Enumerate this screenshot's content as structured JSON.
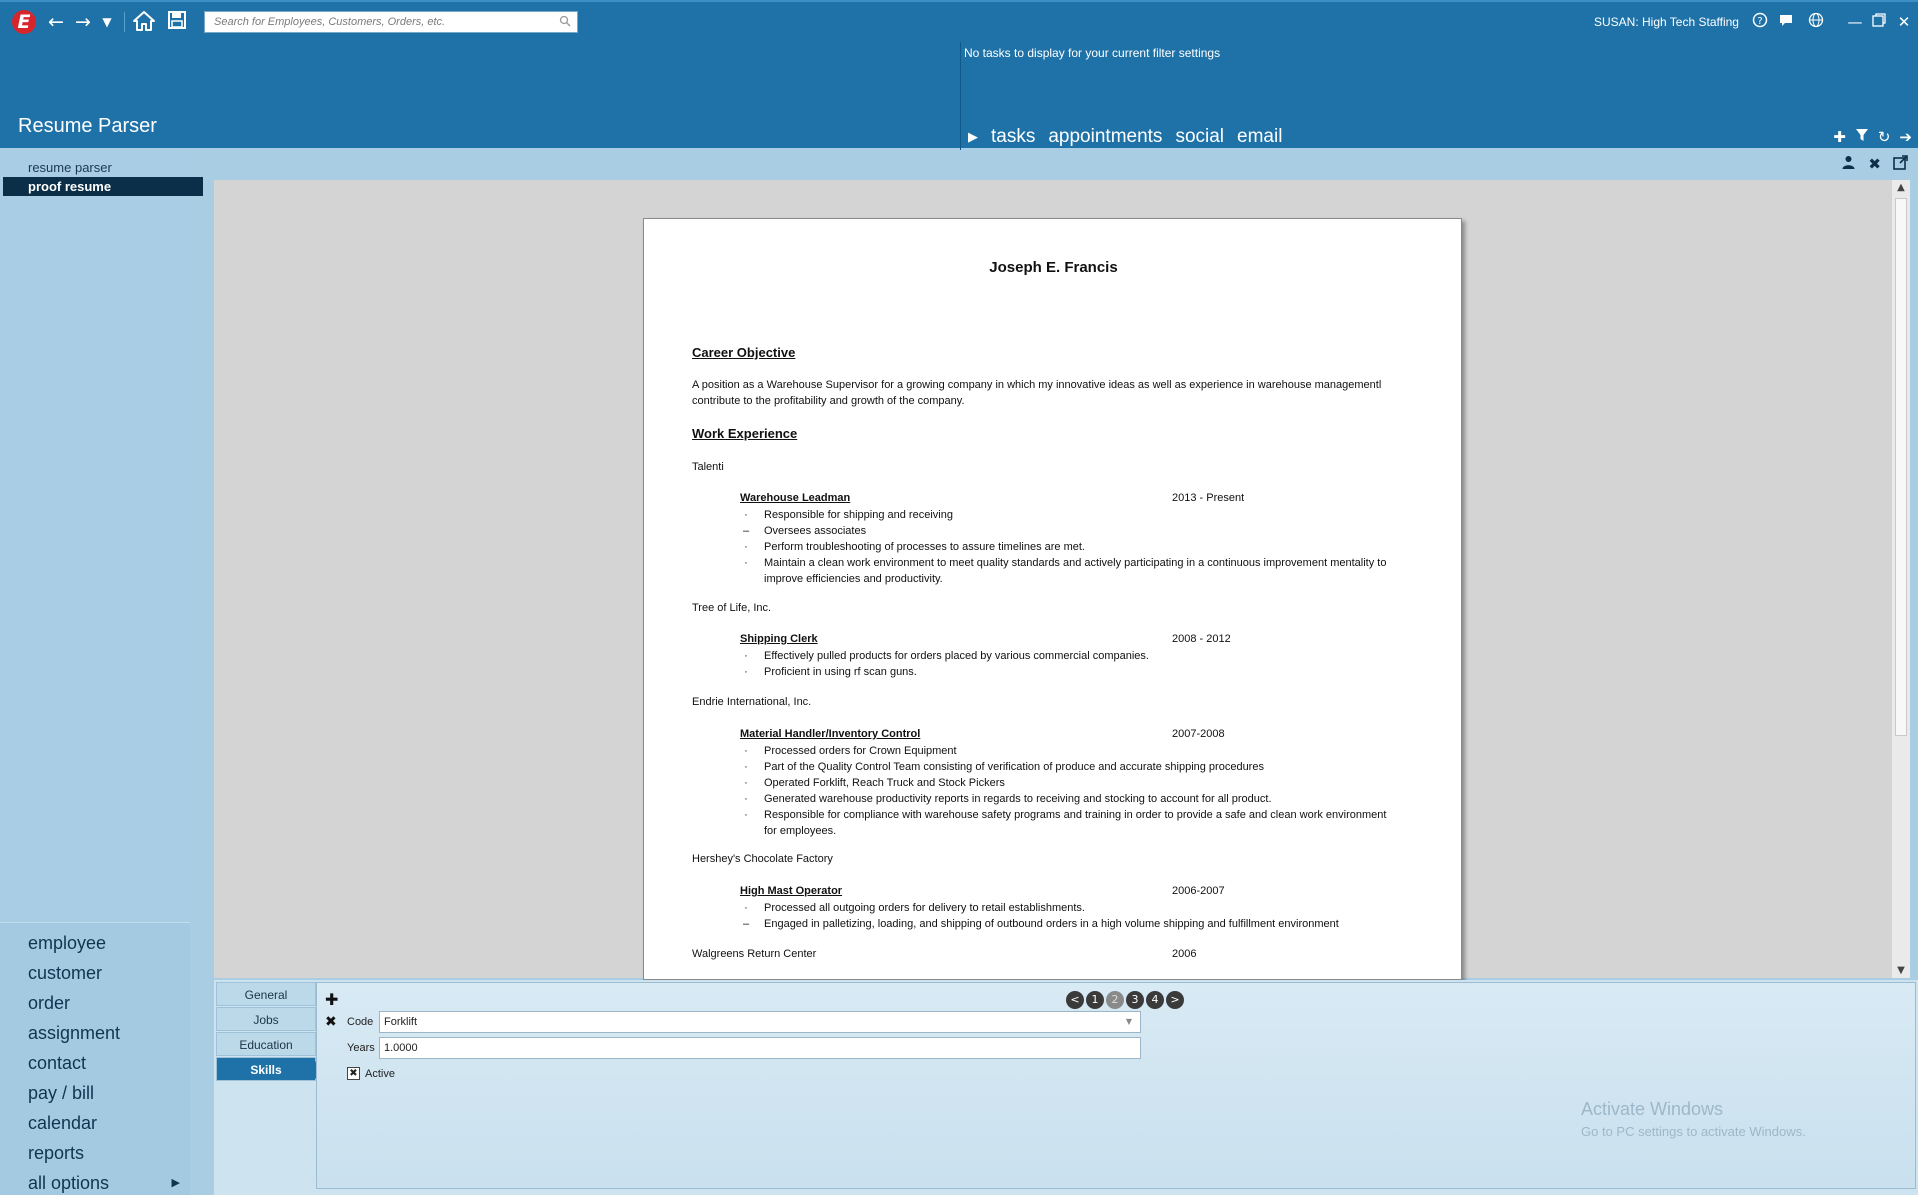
{
  "header": {
    "logo_letter": "E",
    "search_placeholder": "Search for Employees, Customers, Orders, etc.",
    "user": "SUSAN: High Tech Staffing",
    "app_title": "Resume Parser",
    "tasks_message": "No tasks to display for your current filter settings",
    "task_tabs": [
      "tasks",
      "appointments",
      "social",
      "email"
    ]
  },
  "sidebar": {
    "sub_items": [
      "resume parser",
      "proof resume"
    ],
    "nav": [
      "employee",
      "customer",
      "order",
      "assignment",
      "contact",
      "pay / bill",
      "calendar",
      "reports",
      "all options"
    ]
  },
  "resume": {
    "name": "Joseph E. Francis",
    "objective_heading": "Career Objective",
    "objective_text": "A position as a Warehouse Supervisor for a growing company in which my innovative ideas as well as experience in warehouse managementl contribute to the profitability and growth of the company.",
    "experience_heading": "Work Experience",
    "jobs": [
      {
        "company": "Talenti",
        "role": "Warehouse Leadman",
        "dates": "2013 - Present",
        "bullets": [
          "Responsible for shipping and receiving",
          "Oversees associates",
          "Perform troubleshooting of processes to assure timelines are met.",
          "Maintain a clean work environment to meet quality standards and actively participating in a continuous improvement mentality to improve efficiencies and productivity."
        ]
      },
      {
        "company": "Tree of Life, Inc.",
        "role": "Shipping Clerk",
        "dates": "2008 - 2012",
        "bullets": [
          "Effectively pulled products for orders placed by various commercial companies.",
          "Proficient in using rf scan guns."
        ]
      },
      {
        "company": "Endrie International, Inc.",
        "role": "Material Handler/Inventory Control",
        "dates": "2007-2008",
        "bullets": [
          "Processed orders for Crown Equipment",
          "Part of the Quality Control Team consisting of verification of produce and accurate shipping procedures",
          "Operated Forklift, Reach Truck and Stock Pickers",
          "Generated warehouse productivity reports in regards to receiving and stocking to account for all product.",
          "Responsible for compliance with warehouse safety programs and training in order to provide a safe and clean work environment for employees."
        ]
      },
      {
        "company": "Hershey's Chocolate Factory",
        "role": "High Mast Operator",
        "dates": "2006-2007",
        "bullets": [
          "Processed all outgoing orders for delivery to retail establishments.",
          "Engaged in palletizing, loading, and shipping of outbound orders in a high volume shipping and fulfillment environment"
        ]
      },
      {
        "company": "Walgreens Return Center",
        "role": "",
        "dates": "2006",
        "bullets": []
      }
    ]
  },
  "skills_panel": {
    "tabs": [
      "General",
      "Jobs",
      "Education",
      "Skills"
    ],
    "code_label": "Code",
    "code_value": "Forklift",
    "years_label": "Years",
    "years_value": "1.0000",
    "active_label": "Active",
    "pages": [
      "1",
      "2",
      "3",
      "4"
    ],
    "current_page": "2"
  },
  "watermark": {
    "line1": "Activate Windows",
    "line2": "Go to PC settings to activate Windows."
  }
}
